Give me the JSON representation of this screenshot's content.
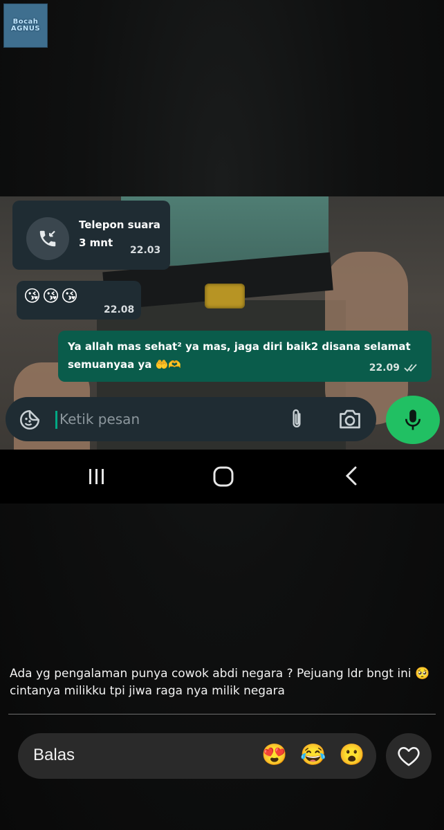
{
  "watermark": {
    "line1": "Bocah",
    "line2": "AGNUS"
  },
  "chat": {
    "call": {
      "title": "Telepon suara",
      "duration": "3 mnt",
      "time": "22.03",
      "icon": "call-incoming-icon"
    },
    "emoji_msg": {
      "emojis": "😘😘😘",
      "time": "22.08"
    },
    "outgoing": {
      "text": "Ya allah mas sehat² ya mas, jaga diri baik2 disana selamat semuanyaa ya 🤲🫶",
      "time": "22.09",
      "status_icon": "double-check-icon"
    },
    "input": {
      "placeholder": "Ketik pesan"
    },
    "colors": {
      "incoming": "#1f2c33",
      "outgoing": "#0a5c4b",
      "mic": "#21c063"
    }
  },
  "navbar": {
    "recent": "recent-apps-icon",
    "home": "home-icon",
    "back": "back-icon"
  },
  "story": {
    "caption": "Ada yg pengalaman punya cowok abdi negara ? Pejuang ldr bngt ini 🥺cintanya milikku tpi jiwa raga nya milik negara",
    "reply_placeholder": "Balas",
    "reactions": [
      "😍",
      "😂",
      "😮"
    ],
    "like_icon": "heart-icon"
  }
}
